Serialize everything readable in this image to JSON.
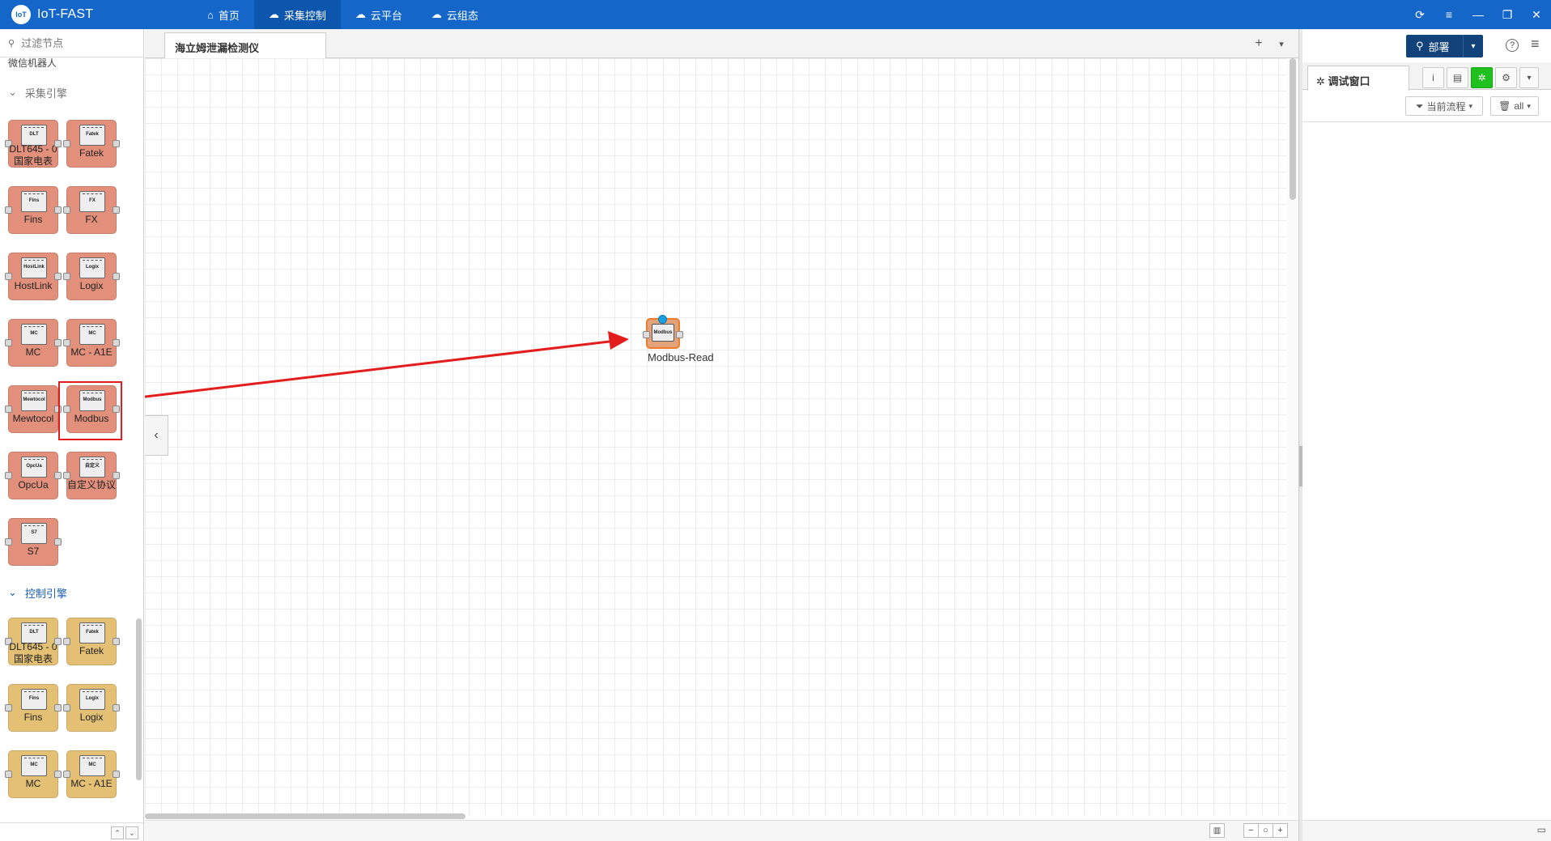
{
  "app": {
    "logo_mark": "IoT",
    "title": "IoT-FAST",
    "nav": [
      {
        "label": "首页",
        "icon": "home-icon",
        "glyph": "⌂"
      },
      {
        "label": "采集控制",
        "icon": "cloud-icon",
        "glyph": "☁"
      },
      {
        "label": "云平台",
        "icon": "cloud-platform-icon",
        "glyph": "☁"
      },
      {
        "label": "云组态",
        "icon": "cloud-config-icon",
        "glyph": "☁"
      }
    ],
    "window_controls": [
      "⟳",
      "≡",
      "—",
      "❐",
      "✕"
    ]
  },
  "palette": {
    "filter_placeholder": "过滤节点",
    "cut_label": "微信机器人",
    "section_collect": "采集引擎",
    "section_control": "控制引擎",
    "collect_nodes": [
      {
        "label": "DLT645 - 0",
        "label2": "国家电表",
        "chip": "DLT"
      },
      {
        "label": "Fatek",
        "chip": "Fatek"
      },
      {
        "label": "Fins",
        "chip": "Fins"
      },
      {
        "label": "FX",
        "chip": "FX"
      },
      {
        "label": "HostLink",
        "chip": "HostLink"
      },
      {
        "label": "Logix",
        "chip": "Logix"
      },
      {
        "label": "MC",
        "chip": "MC"
      },
      {
        "label": "MC - A1E",
        "chip": "MC"
      },
      {
        "label": "Mewtocol",
        "chip": "Mewtocol"
      },
      {
        "label": "Modbus",
        "chip": "Modbus"
      },
      {
        "label": "OpcUa",
        "chip": "OpcUa"
      },
      {
        "label": "自定义协议",
        "chip": "自定义"
      },
      {
        "label": "S7",
        "chip": "S7"
      }
    ],
    "control_nodes": [
      {
        "label": "DLT645 - 0",
        "label2": "国家电表",
        "chip": "DLT"
      },
      {
        "label": "Fatek",
        "chip": "Fatek"
      },
      {
        "label": "Fins",
        "chip": "Fins"
      },
      {
        "label": "Logix",
        "chip": "Logix"
      },
      {
        "label": "MC",
        "chip": "MC"
      },
      {
        "label": "MC - A1E",
        "chip": "MC"
      }
    ],
    "footer_buttons": [
      "⌃",
      "⌄"
    ]
  },
  "workspace": {
    "tab_label": "海立姆泄漏检测仪",
    "add_tab": "+",
    "tab_menu": "▾",
    "flow_node": {
      "label": "Modbus-Read",
      "chip": "Modbus"
    },
    "zoom": [
      "−",
      "○",
      "+"
    ],
    "map_icon": "▥",
    "collapse": "‹"
  },
  "sidebar": {
    "deploy_label": "部署",
    "deploy_dropdown": "▾",
    "help": "?",
    "menu": "≡",
    "debug_tab_label": "调试窗口",
    "debug_tab_icon": "✲",
    "tab_icons": [
      "i",
      "▤",
      "✲",
      "⚙",
      "▾"
    ],
    "filter_flow_label": "当前流程",
    "clear_label": "all",
    "footer_icon": "▭"
  },
  "colors": {
    "topbar": "#1467c9",
    "collect_node": "#e2907b",
    "control_node": "#e3c074",
    "arrow": "#e31c1c",
    "deploy": "#12427a",
    "debug_active": "#1ec11e"
  }
}
